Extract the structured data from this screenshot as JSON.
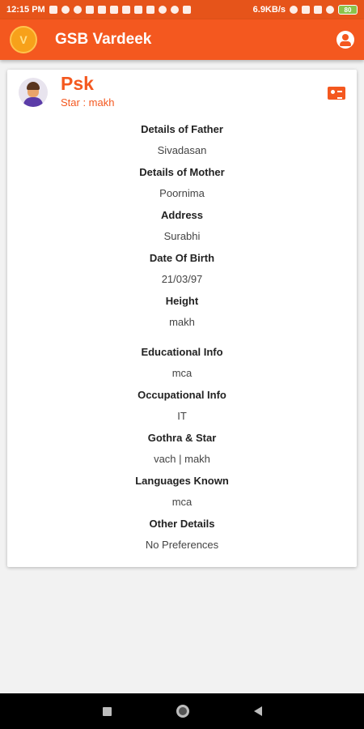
{
  "status_bar": {
    "time": "12:15 PM",
    "network_speed": "6.9KB/s",
    "battery": "80"
  },
  "app_bar": {
    "title": "GSB Vardeek",
    "logo_text": "V"
  },
  "profile": {
    "name": "Psk",
    "star_line": "Star : makh"
  },
  "details": [
    {
      "label": "Details of Father",
      "value": "Sivadasan"
    },
    {
      "label": "Details of Mother",
      "value": "Poornima"
    },
    {
      "label": "Address",
      "value": "Surabhi"
    },
    {
      "label": "Date Of Birth",
      "value": "21/03/97"
    },
    {
      "label": "Height",
      "value": "makh"
    },
    {
      "label": "Educational Info",
      "value": "mca"
    },
    {
      "label": "Occupational Info",
      "value": "IT"
    },
    {
      "label": "Gothra & Star",
      "value": "vach | makh"
    },
    {
      "label": "Languages Known",
      "value": "mca"
    },
    {
      "label": "Other Details",
      "value": "No Preferences"
    }
  ],
  "colors": {
    "accent": "#f4581f",
    "status_bar": "#e6541a"
  },
  "icons": [
    "account-circle-icon",
    "contact-card-icon",
    "avatar-icon"
  ]
}
